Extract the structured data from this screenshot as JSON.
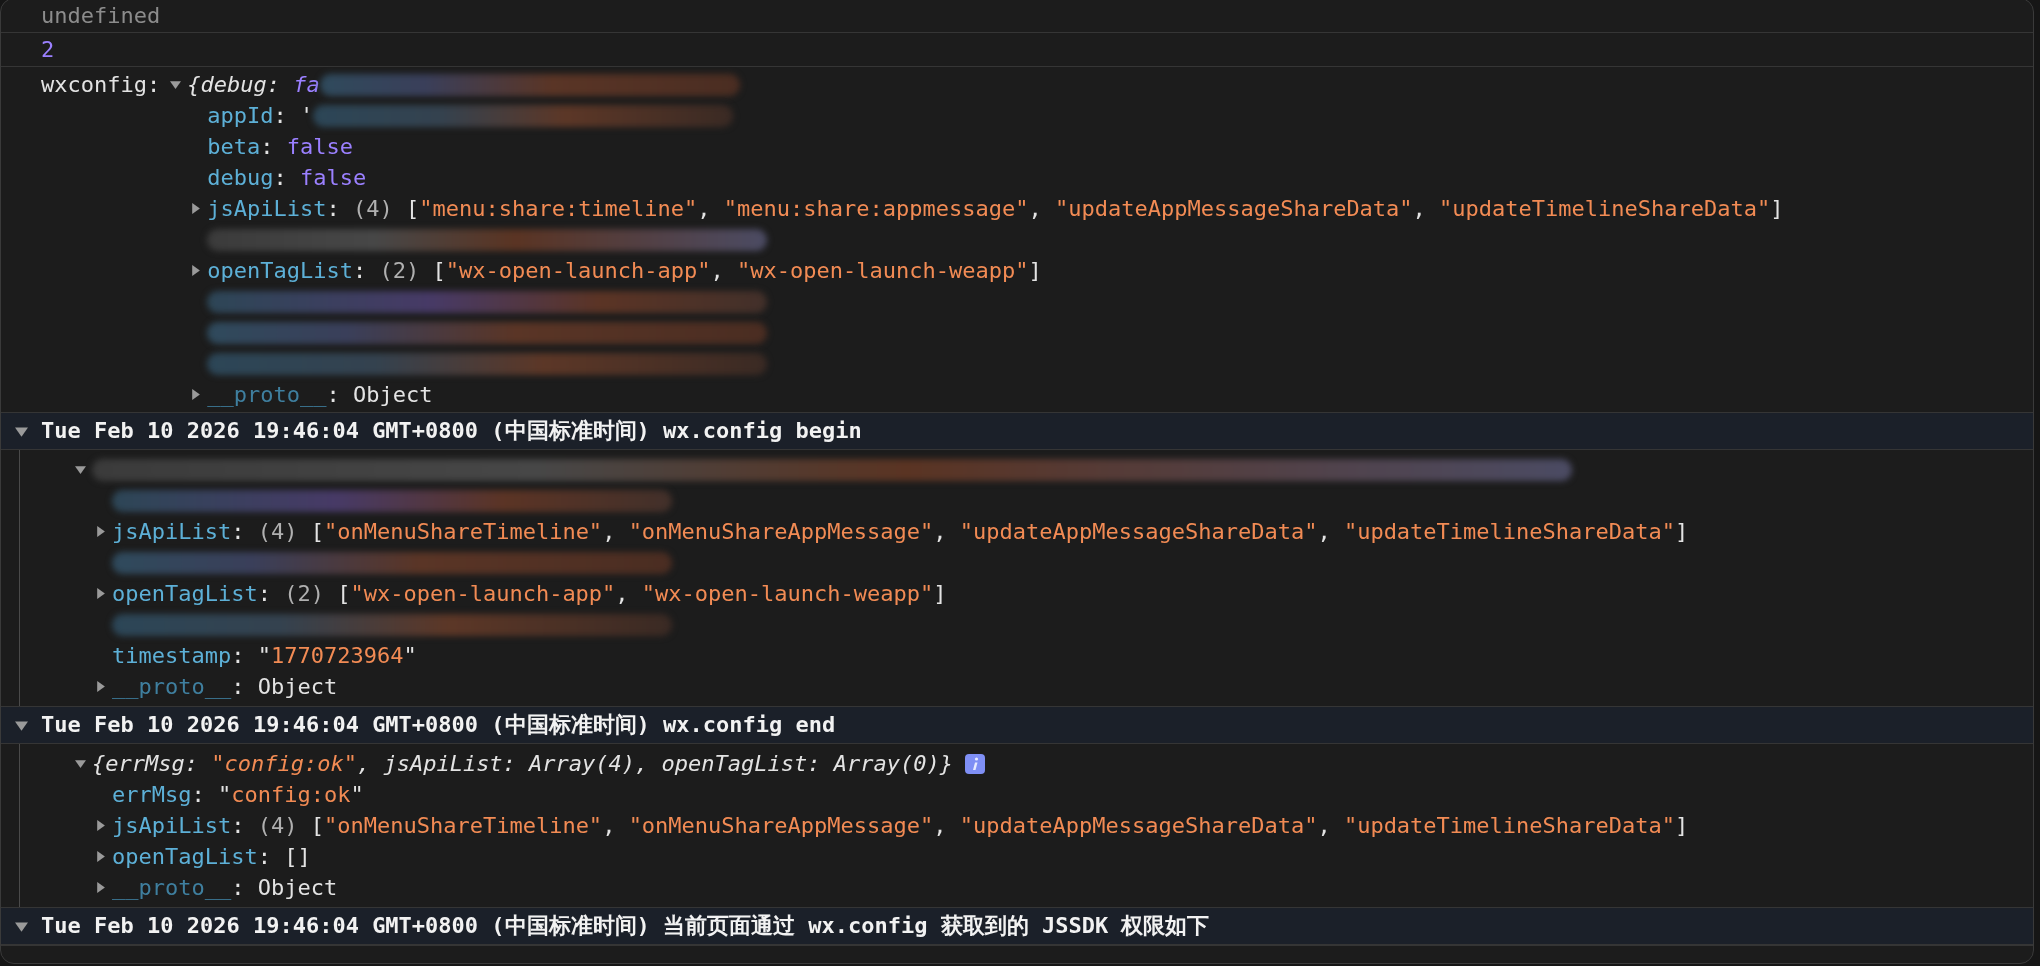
{
  "console": [
    {
      "kind": "value",
      "tokens": [
        {
          "kind": "dim",
          "text": "undefined"
        }
      ]
    },
    {
      "kind": "value",
      "tokens": [
        {
          "kind": "keyword",
          "text": "2"
        }
      ]
    },
    {
      "kind": "log",
      "label": "wxconfig:",
      "tree": {
        "expanded": true,
        "preview": true,
        "redacted": true,
        "tokens": [
          {
            "kind": "plain",
            "text": "{debug: "
          },
          {
            "kind": "keyword",
            "text": "fa"
          }
        ],
        "children": [
          {
            "redacted": true,
            "tokens": [
              {
                "kind": "key",
                "text": "appId"
              },
              {
                "kind": "plain",
                "text": ": '"
              }
            ]
          },
          {
            "tokens": [
              {
                "kind": "key",
                "text": "beta"
              },
              {
                "kind": "plain",
                "text": ": "
              },
              {
                "kind": "keyword",
                "text": "false"
              }
            ]
          },
          {
            "tokens": [
              {
                "kind": "key",
                "text": "debug"
              },
              {
                "kind": "plain",
                "text": ": "
              },
              {
                "kind": "keyword",
                "text": "false"
              }
            ]
          },
          {
            "expanded": false,
            "tokens": [
              {
                "kind": "key",
                "text": "jsApiList"
              },
              {
                "kind": "plain",
                "text": ": "
              },
              {
                "kind": "count",
                "text": "(4)"
              },
              {
                "kind": "plain",
                "text": " ["
              },
              {
                "kind": "string",
                "text": "\"menu:share:timeline\""
              },
              {
                "kind": "plain",
                "text": ", "
              },
              {
                "kind": "string",
                "text": "\"menu:share:appmessage\""
              },
              {
                "kind": "plain",
                "text": ", "
              },
              {
                "kind": "string",
                "text": "\"updateAppMessageShareData\""
              },
              {
                "kind": "plain",
                "text": ", "
              },
              {
                "kind": "string",
                "text": "\"updateTimelineShareData\""
              },
              {
                "kind": "plain",
                "text": "]"
              }
            ]
          },
          {
            "redacted": true
          },
          {
            "expanded": false,
            "tokens": [
              {
                "kind": "key",
                "text": "openTagList"
              },
              {
                "kind": "plain",
                "text": ": "
              },
              {
                "kind": "count",
                "text": "(2)"
              },
              {
                "kind": "plain",
                "text": " ["
              },
              {
                "kind": "string",
                "text": "\"wx-open-launch-app\""
              },
              {
                "kind": "plain",
                "text": ", "
              },
              {
                "kind": "string",
                "text": "\"wx-open-launch-weapp\""
              },
              {
                "kind": "plain",
                "text": "]"
              }
            ]
          },
          {
            "redacted": true
          },
          {
            "redacted": true
          },
          {
            "redacted": true
          },
          {
            "expanded": false,
            "tokens": [
              {
                "kind": "key_dim",
                "text": "__proto__"
              },
              {
                "kind": "plain",
                "text": ": Object"
              }
            ]
          }
        ]
      }
    },
    {
      "kind": "group",
      "expanded": true,
      "title": "Tue Feb 10 2026 19:46:04 GMT+0800 (中国标准时间) wx.config begin",
      "children": [
        {
          "expanded": true,
          "redacted": true,
          "children": [
            {
              "redacted": true
            },
            {
              "expanded": false,
              "tokens": [
                {
                  "kind": "key",
                  "text": "jsApiList"
                },
                {
                  "kind": "plain",
                  "text": ": "
                },
                {
                  "kind": "count",
                  "text": "(4)"
                },
                {
                  "kind": "plain",
                  "text": " ["
                },
                {
                  "kind": "string",
                  "text": "\"onMenuShareTimeline\""
                },
                {
                  "kind": "plain",
                  "text": ", "
                },
                {
                  "kind": "string",
                  "text": "\"onMenuShareAppMessage\""
                },
                {
                  "kind": "plain",
                  "text": ", "
                },
                {
                  "kind": "string",
                  "text": "\"updateAppMessageShareData\""
                },
                {
                  "kind": "plain",
                  "text": ", "
                },
                {
                  "kind": "string",
                  "text": "\"updateTimelineShareData\""
                },
                {
                  "kind": "plain",
                  "text": "]"
                }
              ]
            },
            {
              "redacted": true
            },
            {
              "expanded": false,
              "tokens": [
                {
                  "kind": "key",
                  "text": "openTagList"
                },
                {
                  "kind": "plain",
                  "text": ": "
                },
                {
                  "kind": "count",
                  "text": "(2)"
                },
                {
                  "kind": "plain",
                  "text": " ["
                },
                {
                  "kind": "string",
                  "text": "\"wx-open-launch-app\""
                },
                {
                  "kind": "plain",
                  "text": ", "
                },
                {
                  "kind": "string",
                  "text": "\"wx-open-launch-weapp\""
                },
                {
                  "kind": "plain",
                  "text": "]"
                }
              ]
            },
            {
              "redacted": true
            },
            {
              "tokens": [
                {
                  "kind": "key",
                  "text": "timestamp"
                },
                {
                  "kind": "plain",
                  "text": ": \""
                },
                {
                  "kind": "string",
                  "text": "1770723964"
                },
                {
                  "kind": "plain",
                  "text": "\""
                }
              ]
            },
            {
              "expanded": false,
              "tokens": [
                {
                  "kind": "key_dim",
                  "text": "__proto__"
                },
                {
                  "kind": "plain",
                  "text": ": Object"
                }
              ]
            }
          ]
        }
      ]
    },
    {
      "kind": "group",
      "expanded": true,
      "title": "Tue Feb 10 2026 19:46:04 GMT+0800 (中国标准时间) wx.config end",
      "children": [
        {
          "expanded": true,
          "preview": true,
          "info": true,
          "tokens": [
            {
              "kind": "plain",
              "text": "{errMsg: "
            },
            {
              "kind": "string",
              "text": "\"config:ok\""
            },
            {
              "kind": "plain",
              "text": ", jsApiList: Array(4), openTagList: Array(0)}"
            }
          ],
          "children": [
            {
              "tokens": [
                {
                  "kind": "key",
                  "text": "errMsg"
                },
                {
                  "kind": "plain",
                  "text": ": \""
                },
                {
                  "kind": "string",
                  "text": "config:ok"
                },
                {
                  "kind": "plain",
                  "text": "\""
                }
              ]
            },
            {
              "expanded": false,
              "tokens": [
                {
                  "kind": "key",
                  "text": "jsApiList"
                },
                {
                  "kind": "plain",
                  "text": ": "
                },
                {
                  "kind": "count",
                  "text": "(4)"
                },
                {
                  "kind": "plain",
                  "text": " ["
                },
                {
                  "kind": "string",
                  "text": "\"onMenuShareTimeline\""
                },
                {
                  "kind": "plain",
                  "text": ", "
                },
                {
                  "kind": "string",
                  "text": "\"onMenuShareAppMessage\""
                },
                {
                  "kind": "plain",
                  "text": ", "
                },
                {
                  "kind": "string",
                  "text": "\"updateAppMessageShareData\""
                },
                {
                  "kind": "plain",
                  "text": ", "
                },
                {
                  "kind": "string",
                  "text": "\"updateTimelineShareData\""
                },
                {
                  "kind": "plain",
                  "text": "]"
                }
              ]
            },
            {
              "expanded": false,
              "tokens": [
                {
                  "kind": "key",
                  "text": "openTagList"
                },
                {
                  "kind": "plain",
                  "text": ": []"
                }
              ]
            },
            {
              "expanded": false,
              "tokens": [
                {
                  "kind": "key_dim",
                  "text": "__proto__"
                },
                {
                  "kind": "plain",
                  "text": ": Object"
                }
              ]
            }
          ]
        }
      ]
    },
    {
      "kind": "group",
      "expanded": true,
      "title": "Tue Feb 10 2026 19:46:04 GMT+0800 (中国标准时间) 当前页面通过 wx.config 获取到的 JSSDK 权限如下"
    }
  ]
}
